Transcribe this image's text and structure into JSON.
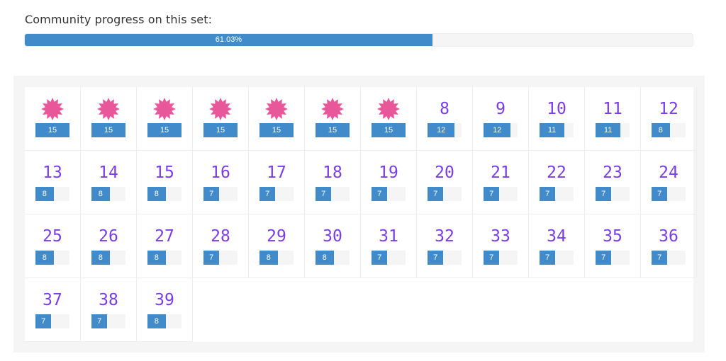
{
  "header": {
    "progress_label": "Community progress on this set:",
    "progress_text": "61.03%",
    "progress_value": 0.6103
  },
  "colors": {
    "bar": "#428bca",
    "number": "#7a3dea",
    "star": "#e8579a"
  },
  "max_count": 15,
  "cells": [
    {
      "label": "",
      "completed": true,
      "count": 15
    },
    {
      "label": "",
      "completed": true,
      "count": 15
    },
    {
      "label": "",
      "completed": true,
      "count": 15
    },
    {
      "label": "",
      "completed": true,
      "count": 15
    },
    {
      "label": "",
      "completed": true,
      "count": 15
    },
    {
      "label": "",
      "completed": true,
      "count": 15
    },
    {
      "label": "",
      "completed": true,
      "count": 15
    },
    {
      "label": "8",
      "completed": false,
      "count": 12
    },
    {
      "label": "9",
      "completed": false,
      "count": 12
    },
    {
      "label": "10",
      "completed": false,
      "count": 11
    },
    {
      "label": "11",
      "completed": false,
      "count": 11
    },
    {
      "label": "12",
      "completed": false,
      "count": 8
    },
    {
      "label": "13",
      "completed": false,
      "count": 8
    },
    {
      "label": "14",
      "completed": false,
      "count": 8
    },
    {
      "label": "15",
      "completed": false,
      "count": 8
    },
    {
      "label": "16",
      "completed": false,
      "count": 7
    },
    {
      "label": "17",
      "completed": false,
      "count": 7
    },
    {
      "label": "18",
      "completed": false,
      "count": 7
    },
    {
      "label": "19",
      "completed": false,
      "count": 7
    },
    {
      "label": "20",
      "completed": false,
      "count": 7
    },
    {
      "label": "21",
      "completed": false,
      "count": 7
    },
    {
      "label": "22",
      "completed": false,
      "count": 7
    },
    {
      "label": "23",
      "completed": false,
      "count": 7
    },
    {
      "label": "24",
      "completed": false,
      "count": 7
    },
    {
      "label": "25",
      "completed": false,
      "count": 8
    },
    {
      "label": "26",
      "completed": false,
      "count": 8
    },
    {
      "label": "27",
      "completed": false,
      "count": 8
    },
    {
      "label": "28",
      "completed": false,
      "count": 7
    },
    {
      "label": "29",
      "completed": false,
      "count": 8
    },
    {
      "label": "30",
      "completed": false,
      "count": 8
    },
    {
      "label": "31",
      "completed": false,
      "count": 7
    },
    {
      "label": "32",
      "completed": false,
      "count": 7
    },
    {
      "label": "33",
      "completed": false,
      "count": 7
    },
    {
      "label": "34",
      "completed": false,
      "count": 7
    },
    {
      "label": "35",
      "completed": false,
      "count": 7
    },
    {
      "label": "36",
      "completed": false,
      "count": 7
    },
    {
      "label": "37",
      "completed": false,
      "count": 7
    },
    {
      "label": "38",
      "completed": false,
      "count": 7
    },
    {
      "label": "39",
      "completed": false,
      "count": 8
    }
  ]
}
